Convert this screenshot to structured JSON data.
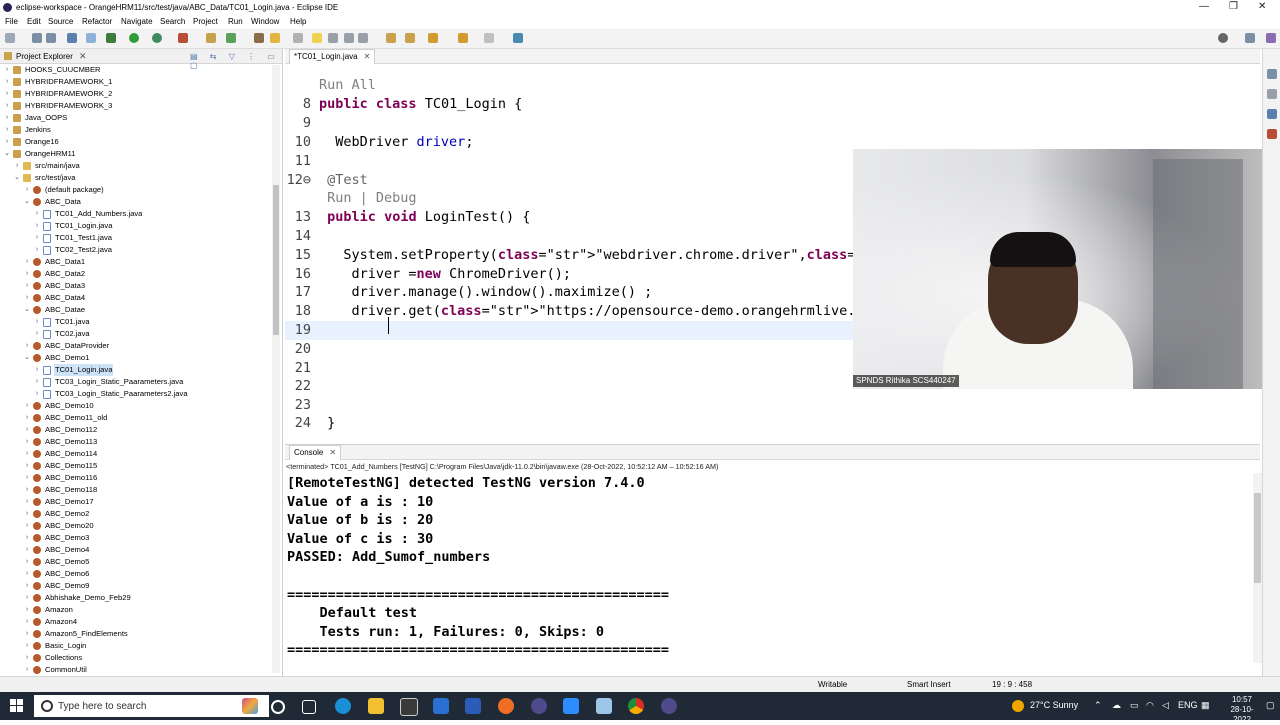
{
  "window": {
    "title": "eclipse-workspace - OrangeHRM11/src/test/java/ABC_Data/TC01_Login.java - Eclipse IDE",
    "controls": [
      "—",
      "❐",
      "✕"
    ]
  },
  "menu": [
    "File",
    "Edit",
    "Source",
    "Refactor",
    "Navigate",
    "Search",
    "Project",
    "Run",
    "Window",
    "Help"
  ],
  "explorer": {
    "title": "Project Explorer",
    "close": "✕",
    "items": [
      {
        "label": "HOOKS_CUUCMBER",
        "level": 0,
        "type": "project",
        "arrow": "›"
      },
      {
        "label": "HYBRIDFRAMEWORK_1",
        "level": 0,
        "type": "project",
        "arrow": "›"
      },
      {
        "label": "HYBRIDFRAMEWORK_2",
        "level": 0,
        "type": "project",
        "arrow": "›"
      },
      {
        "label": "HYBRIDFRAMEWORK_3",
        "level": 0,
        "type": "project",
        "arrow": "›"
      },
      {
        "label": "Java_OOPS",
        "level": 0,
        "type": "project",
        "arrow": "›"
      },
      {
        "label": "Jenkins",
        "level": 0,
        "type": "project",
        "arrow": "›"
      },
      {
        "label": "Orange16",
        "level": 0,
        "type": "project",
        "arrow": "›"
      },
      {
        "label": "OrangeHRM11",
        "level": 0,
        "type": "project",
        "arrow": "⌄"
      },
      {
        "label": "src/main/java",
        "level": 1,
        "type": "folder",
        "arrow": "›"
      },
      {
        "label": "src/test/java",
        "level": 1,
        "type": "folder",
        "arrow": "⌄"
      },
      {
        "label": "(default package)",
        "level": 2,
        "type": "pkg",
        "arrow": "›"
      },
      {
        "label": "ABC_Data",
        "level": 2,
        "type": "pkg",
        "arrow": "⌄"
      },
      {
        "label": "TC01_Add_Numbers.java",
        "level": 3,
        "type": "java",
        "arrow": "›"
      },
      {
        "label": "TC01_Login.java",
        "level": 3,
        "type": "java",
        "arrow": "›"
      },
      {
        "label": "TC01_Test1.java",
        "level": 3,
        "type": "java",
        "arrow": "›"
      },
      {
        "label": "TC02_Test2.java",
        "level": 3,
        "type": "java",
        "arrow": "›"
      },
      {
        "label": "ABC_Data1",
        "level": 2,
        "type": "pkg",
        "arrow": "›"
      },
      {
        "label": "ABC_Data2",
        "level": 2,
        "type": "pkg",
        "arrow": "›"
      },
      {
        "label": "ABC_Data3",
        "level": 2,
        "type": "pkg",
        "arrow": "›"
      },
      {
        "label": "ABC_Data4",
        "level": 2,
        "type": "pkg",
        "arrow": "›"
      },
      {
        "label": "ABC_Datae",
        "level": 2,
        "type": "pkg",
        "arrow": "⌄"
      },
      {
        "label": "TC01.java",
        "level": 3,
        "type": "java",
        "arrow": "›"
      },
      {
        "label": "TC02.java",
        "level": 3,
        "type": "java",
        "arrow": "›"
      },
      {
        "label": "ABC_DataProvider",
        "level": 2,
        "type": "pkg",
        "arrow": "›"
      },
      {
        "label": "ABC_Demo1",
        "level": 2,
        "type": "pkg",
        "arrow": "⌄"
      },
      {
        "label": "TC01_Login.java",
        "level": 3,
        "type": "java",
        "arrow": "›",
        "selected": true
      },
      {
        "label": "TC03_Login_Static_Paarameters.java",
        "level": 3,
        "type": "java",
        "arrow": "›"
      },
      {
        "label": "TC03_Login_Static_Paarameters2.java",
        "level": 3,
        "type": "java",
        "arrow": "›"
      },
      {
        "label": "ABC_Demo10",
        "level": 2,
        "type": "pkg",
        "arrow": "›"
      },
      {
        "label": "ABC_Demo11_old",
        "level": 2,
        "type": "pkg",
        "arrow": "›"
      },
      {
        "label": "ABC_Demo112",
        "level": 2,
        "type": "pkg",
        "arrow": "›"
      },
      {
        "label": "ABC_Demo113",
        "level": 2,
        "type": "pkg",
        "arrow": "›"
      },
      {
        "label": "ABC_Demo114",
        "level": 2,
        "type": "pkg",
        "arrow": "›"
      },
      {
        "label": "ABC_Demo115",
        "level": 2,
        "type": "pkg",
        "arrow": "›"
      },
      {
        "label": "ABC_Demo116",
        "level": 2,
        "type": "pkg",
        "arrow": "›"
      },
      {
        "label": "ABC_Demo118",
        "level": 2,
        "type": "pkg",
        "arrow": "›"
      },
      {
        "label": "ABC_Demo17",
        "level": 2,
        "type": "pkg",
        "arrow": "›"
      },
      {
        "label": "ABC_Demo2",
        "level": 2,
        "type": "pkg",
        "arrow": "›"
      },
      {
        "label": "ABC_Demo20",
        "level": 2,
        "type": "pkg",
        "arrow": "›"
      },
      {
        "label": "ABC_Demo3",
        "level": 2,
        "type": "pkg",
        "arrow": "›"
      },
      {
        "label": "ABC_Demo4",
        "level": 2,
        "type": "pkg",
        "arrow": "›"
      },
      {
        "label": "ABC_Demo5",
        "level": 2,
        "type": "pkg",
        "arrow": "›"
      },
      {
        "label": "ABC_Demo6",
        "level": 2,
        "type": "pkg",
        "arrow": "›"
      },
      {
        "label": "ABC_Demo9",
        "level": 2,
        "type": "pkg",
        "arrow": "›"
      },
      {
        "label": "Abhishake_Demo_Feb29",
        "level": 2,
        "type": "pkg",
        "arrow": "›"
      },
      {
        "label": "Amazon",
        "level": 2,
        "type": "pkg",
        "arrow": "›"
      },
      {
        "label": "Amazon4",
        "level": 2,
        "type": "pkg",
        "arrow": "›"
      },
      {
        "label": "Amazon5_FindElements",
        "level": 2,
        "type": "pkg",
        "arrow": "›"
      },
      {
        "label": "Basic_Login",
        "level": 2,
        "type": "pkg",
        "arrow": "›"
      },
      {
        "label": "Collections",
        "level": 2,
        "type": "pkg",
        "arrow": "›"
      },
      {
        "label": "CommonUtil",
        "level": 2,
        "type": "pkg",
        "arrow": "›"
      }
    ]
  },
  "editor": {
    "tab_label": "*TC01_Login.java",
    "tab_close": "✕",
    "lines": [
      {
        "num": "",
        "code": "Run All",
        "style": "lens"
      },
      {
        "num": "8",
        "code": "public class TC01_Login {"
      },
      {
        "num": "9",
        "code": ""
      },
      {
        "num": "10",
        "code": "  WebDriver driver;"
      },
      {
        "num": "11",
        "code": ""
      },
      {
        "num": "12⊖",
        "code": " @Test",
        "style": "ann"
      },
      {
        "num": "",
        "code": " Run | Debug",
        "style": "lens"
      },
      {
        "num": "13",
        "code": " public void LoginTest() {"
      },
      {
        "num": "14",
        "code": ""
      },
      {
        "num": "15",
        "code": "   System.setProperty(\"webdriver.chrome.driver\",\"C:\\\\chromedriver.exe\");"
      },
      {
        "num": "16",
        "code": "    driver =new ChromeDriver();"
      },
      {
        "num": "17",
        "code": "    driver.manage().window().maximize() ;"
      },
      {
        "num": "18",
        "code": "    driver.get(\"https://opensource-demo.orangehrmlive.com/\");"
      },
      {
        "num": "19",
        "code": "",
        "current": true
      },
      {
        "num": "20",
        "code": ""
      },
      {
        "num": "21",
        "code": ""
      },
      {
        "num": "22",
        "code": ""
      },
      {
        "num": "23",
        "code": ""
      },
      {
        "num": "24",
        "code": " }"
      }
    ]
  },
  "webcam": {
    "name_label": "SPNDS Rithika SCS440247"
  },
  "console": {
    "tab_label": "Console",
    "tab_close": "✕",
    "status": "<terminated> TC01_Add_Numbers [TestNG] C:\\Program Files\\Java\\jdk-11.0.2\\bin\\javaw.exe  (28-Oct-2022, 10:52:12 AM – 10:52:16 AM)",
    "output": [
      "[RemoteTestNG] detected TestNG version 7.4.0",
      "Value of a is : 10",
      "Value of b is : 20",
      "Value of c is : 30",
      "PASSED: Add_Sumof_numbers",
      "",
      "===============================================",
      "    Default test",
      "    Tests run: 1, Failures: 0, Skips: 0",
      "==============================================="
    ]
  },
  "statusbar": {
    "mode": "Writable",
    "insert": "Smart Insert",
    "position": "19 : 9 : 458"
  },
  "taskbar": {
    "search_placeholder": "Type here to search",
    "weather": "27°C  Sunny",
    "lang": "ENG",
    "time": "10:57",
    "date": "28-10-2022"
  }
}
